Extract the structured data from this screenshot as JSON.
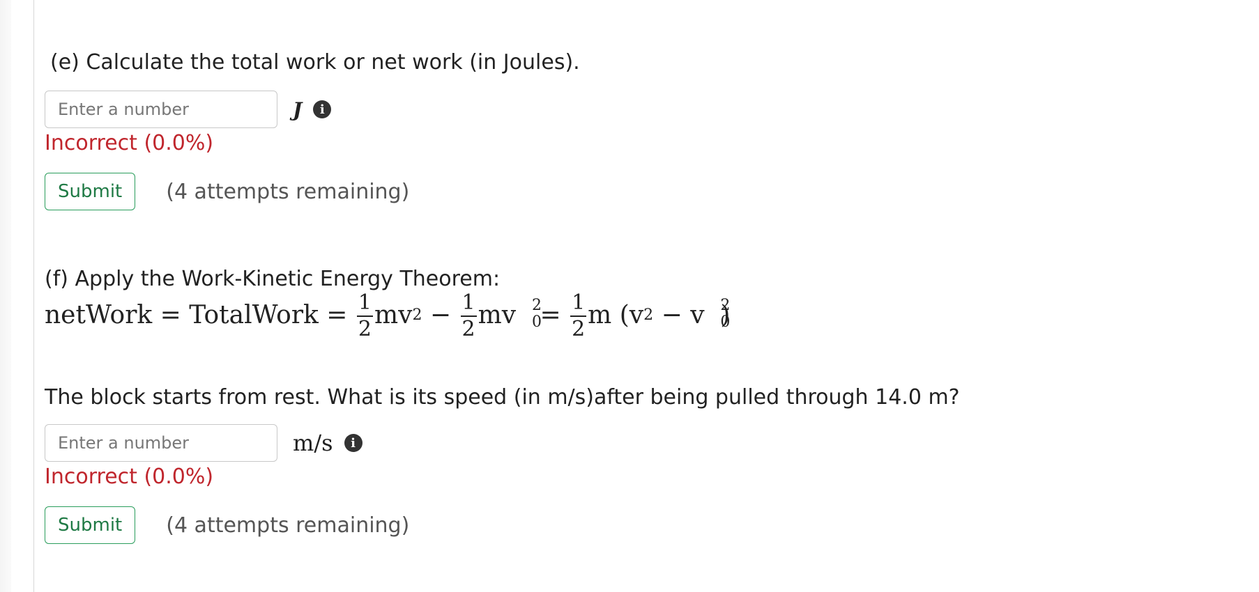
{
  "part_e": {
    "title": "(e) Calculate the total work or net work  (in Joules).",
    "input_placeholder": "Enter a number",
    "unit": "J",
    "info_icon": "info-circle-icon",
    "status": "Incorrect (0.0%)",
    "submit_label": "Submit",
    "attempts": "(4 attempts remaining)"
  },
  "part_f": {
    "title": "(f) Apply the Work-Kinetic Energy Theorem:",
    "equation": {
      "lhs": "netWork = TotalWork = ",
      "half": {
        "num": "1",
        "den": "2"
      },
      "term1": "mv",
      "minus": " − ",
      "term2": "mv",
      "equals": " = ",
      "term3": "m (v",
      "minus2": " − v",
      "close": ")",
      "exp2": "2",
      "sub0": "0"
    },
    "question": "The block starts from rest. What is its speed (in m/s)after being pulled through 14.0 m?",
    "input_placeholder": "Enter a number",
    "unit": "m/s",
    "info_icon": "info-circle-icon",
    "status": "Incorrect (0.0%)",
    "submit_label": "Submit",
    "attempts": "(4 attempts remaining)"
  },
  "colors": {
    "incorrect": "#c0262d",
    "submit_border": "#2a9d5c",
    "submit_text": "#1f7a45"
  }
}
